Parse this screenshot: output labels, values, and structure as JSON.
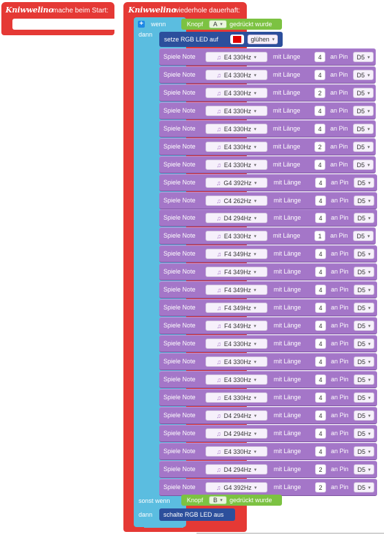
{
  "start_block": {
    "logo": "Kniwwelino",
    "label": "mache beim Start:"
  },
  "loop_block": {
    "logo": "Kniwwelino",
    "label": "wiederhole dauerhaft:"
  },
  "if_block": {
    "if_label": "wenn",
    "then_label": "dann",
    "elseif_label": "sonst wenn",
    "then2_label": "dann",
    "condition1": {
      "prefix": "Knopf",
      "button": "A",
      "suffix": "gedrückt wurde"
    },
    "condition2": {
      "prefix": "Knopf",
      "button": "B",
      "suffix": "gedrückt wurde"
    }
  },
  "rgb_block": {
    "label": "setze RGB LED auf",
    "color": "#e00000",
    "mode": "glühen"
  },
  "rgb_off_block": {
    "label": "schalte RGB LED aus"
  },
  "note_labels": {
    "play": "Spiele Note",
    "length": "mit Länge",
    "pin": "an Pin"
  },
  "notes": [
    {
      "note": "E4 330Hz",
      "length": "4",
      "pin": "D5"
    },
    {
      "note": "E4 330Hz",
      "length": "4",
      "pin": "D5"
    },
    {
      "note": "E4 330Hz",
      "length": "2",
      "pin": "D5"
    },
    {
      "note": "E4 330Hz",
      "length": "4",
      "pin": "D5"
    },
    {
      "note": "E4 330Hz",
      "length": "4",
      "pin": "D5"
    },
    {
      "note": "E4 330Hz",
      "length": "2",
      "pin": "D5"
    },
    {
      "note": "E4 330Hz",
      "length": "4",
      "pin": "D5"
    },
    {
      "note": "G4 392Hz",
      "length": "4",
      "pin": "D5"
    },
    {
      "note": "C4 262Hz",
      "length": "4",
      "pin": "D5"
    },
    {
      "note": "D4 294Hz",
      "length": "4",
      "pin": "D5"
    },
    {
      "note": "E4 330Hz",
      "length": "1",
      "pin": "D5"
    },
    {
      "note": "F4 349Hz",
      "length": "4",
      "pin": "D5"
    },
    {
      "note": "F4 349Hz",
      "length": "4",
      "pin": "D5"
    },
    {
      "note": "F4 349Hz",
      "length": "4",
      "pin": "D5"
    },
    {
      "note": "F4 349Hz",
      "length": "4",
      "pin": "D5"
    },
    {
      "note": "F4 349Hz",
      "length": "4",
      "pin": "D5"
    },
    {
      "note": "E4 330Hz",
      "length": "4",
      "pin": "D5"
    },
    {
      "note": "E4 330Hz",
      "length": "4",
      "pin": "D5"
    },
    {
      "note": "E4 330Hz",
      "length": "4",
      "pin": "D5"
    },
    {
      "note": "E4 330Hz",
      "length": "4",
      "pin": "D5"
    },
    {
      "note": "D4 294Hz",
      "length": "4",
      "pin": "D5"
    },
    {
      "note": "D4 294Hz",
      "length": "4",
      "pin": "D5"
    },
    {
      "note": "E4 330Hz",
      "length": "4",
      "pin": "D5"
    },
    {
      "note": "D4 294Hz",
      "length": "2",
      "pin": "D5"
    },
    {
      "note": "G4 392Hz",
      "length": "2",
      "pin": "D5"
    }
  ]
}
